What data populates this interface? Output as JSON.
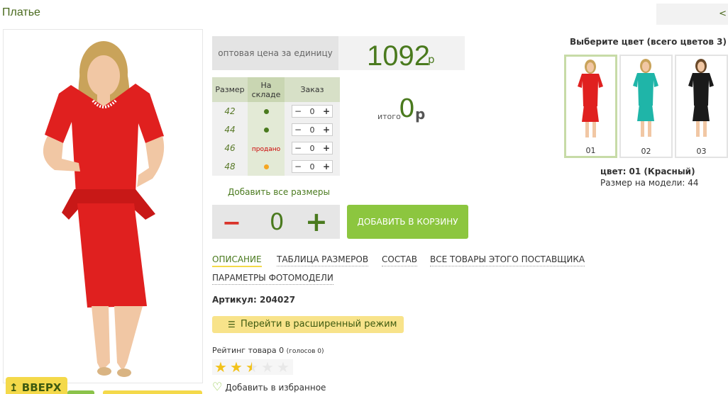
{
  "header": {
    "title": "Платье",
    "prev_nav": "<"
  },
  "price": {
    "label": "оптовая цена за единицу",
    "value": "1092",
    "currency": "р"
  },
  "sizes": {
    "headers": [
      "Размер",
      "На складе",
      "Заказ"
    ],
    "rows": [
      {
        "size": "42",
        "stock": "dot-green",
        "order": "0"
      },
      {
        "size": "44",
        "stock": "dot-green",
        "order": "0"
      },
      {
        "size": "46",
        "stock": "продано",
        "order": "0"
      },
      {
        "size": "48",
        "stock": "dot-orange",
        "order": "0"
      }
    ],
    "stepper_minus": "−",
    "stepper_plus": "+"
  },
  "total": {
    "label": "итого",
    "value": "0",
    "currency": "р"
  },
  "add_all_label": "Добавить все размеры",
  "quantity": {
    "minus": "−",
    "value": "0",
    "plus": "+"
  },
  "cart_button": "ДОБАВИТЬ В КОРЗИНУ",
  "tabs": [
    {
      "label": "ОПИСАНИЕ",
      "active": true
    },
    {
      "label": "ТАБЛИЦА РАЗМЕРОВ"
    },
    {
      "label": "СОСТАВ"
    },
    {
      "label": "ВСЕ ТОВАРЫ ЭТОГО ПОСТАВЩИКА"
    },
    {
      "label": "ПАРАМЕТРЫ ФОТОМОДЕЛИ"
    }
  ],
  "article": "Артикул: 204027",
  "extended_mode": {
    "icon": "list-icon",
    "label": "Перейти в расширенный режим"
  },
  "rating": {
    "label": "Рейтинг товара 0",
    "votes": "(голосов 0)",
    "stars_filled": 2.5,
    "stars_total": 5
  },
  "favorite": {
    "icon": "heart-icon",
    "label": "Добавить в избранное"
  },
  "up_button": "ВВЕРХ",
  "colors": {
    "title": "Выберите цвет (всего цветов 3)",
    "swatches": [
      {
        "num": "01",
        "color": "#e0201f",
        "selected": true
      },
      {
        "num": "02",
        "color": "#1fb5a8"
      },
      {
        "num": "03",
        "color": "#1a1a1a"
      }
    ],
    "selected_name": "цвет: 01 (Красный)",
    "model_size": "Размер на модели: 44"
  },
  "accent": {
    "green": "#4a7a1e",
    "button_green": "#8cc63f",
    "yellow": "#f4d94a",
    "dress_red": "#e0201f"
  }
}
